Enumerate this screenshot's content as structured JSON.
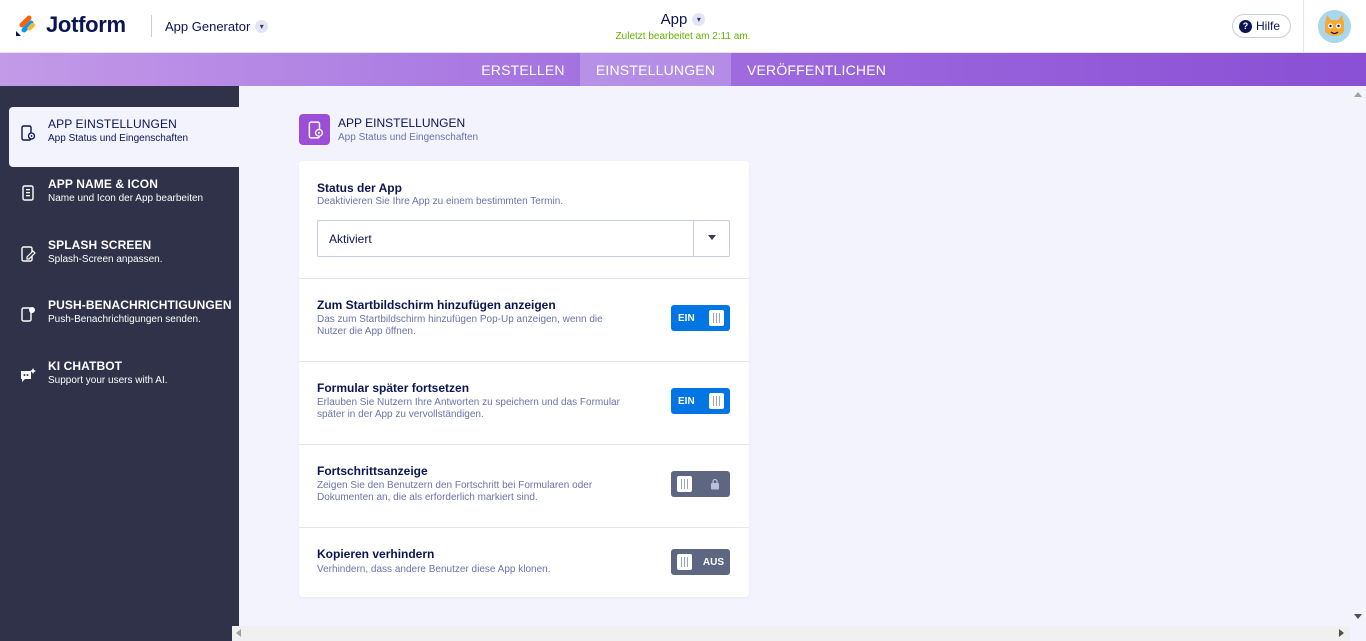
{
  "header": {
    "brand": "Jotform",
    "product": "App Generator",
    "app_title": "App",
    "edited_status": "Zuletzt bearbeitet am 2:11 am.",
    "help_label": "Hilfe"
  },
  "tabs": [
    {
      "label": "ERSTELLEN",
      "active": false
    },
    {
      "label": "EINSTELLUNGEN",
      "active": true
    },
    {
      "label": "VERÖFFENTLICHEN",
      "active": false
    }
  ],
  "sidebar": {
    "items": [
      {
        "title": "APP EINSTELLUNGEN",
        "subtitle": "App Status und Eingenschaften",
        "icon": "phone-settings-icon",
        "active": true
      },
      {
        "title": "APP NAME & ICON",
        "subtitle": "Name und Icon der App bearbeiten",
        "icon": "app-name-icon",
        "active": false
      },
      {
        "title": "SPLASH SCREEN",
        "subtitle": "Splash-Screen anpassen.",
        "icon": "splash-edit-icon",
        "active": false
      },
      {
        "title": "PUSH-BENACHRICHTIGUNGEN",
        "subtitle": "Push-Benachrichtigungen senden.",
        "icon": "push-notification-icon",
        "active": false
      },
      {
        "title": "KI CHATBOT",
        "subtitle": "Support your users with AI.",
        "icon": "chatbot-icon",
        "active": false
      }
    ]
  },
  "main": {
    "title": "APP EINSTELLUNGEN",
    "subtitle": "App Status und Eingenschaften",
    "status": {
      "label": "Status der App",
      "description": "Deaktivieren Sie Ihre App zu einem bestimmten Termin.",
      "selected": "Aktiviert"
    },
    "settings": [
      {
        "label": "Zum Startbildschirm hinzufügen anzeigen",
        "description": "Das zum Startbildschirm hinzufügen Pop-Up anzeigen, wenn die Nutzer die App öffnen.",
        "toggle_text": "EIN",
        "state": "on"
      },
      {
        "label": "Formular später fortsetzen",
        "description": "Erlauben Sie Nutzern Ihre Antworten zu speichern und das Formular später in der App zu vervollständigen.",
        "toggle_text": "EIN",
        "state": "on"
      },
      {
        "label": "Fortschrittsanzeige",
        "description": "Zeigen Sie den Benutzern den Fortschritt bei Formularen oder Dokumenten an, die als erforderlich markiert sind.",
        "toggle_text": "",
        "state": "locked"
      },
      {
        "label": "Kopieren verhindern",
        "description": "Verhindern, dass andere Benutzer diese App klonen.",
        "toggle_text": "AUS",
        "state": "off"
      }
    ]
  },
  "colors": {
    "accent_blue": "#0075e3",
    "toggle_off": "#5e6682",
    "sidebar_bg": "#2f3249",
    "edited_green": "#64b200",
    "purple": "#9c4ed6"
  }
}
